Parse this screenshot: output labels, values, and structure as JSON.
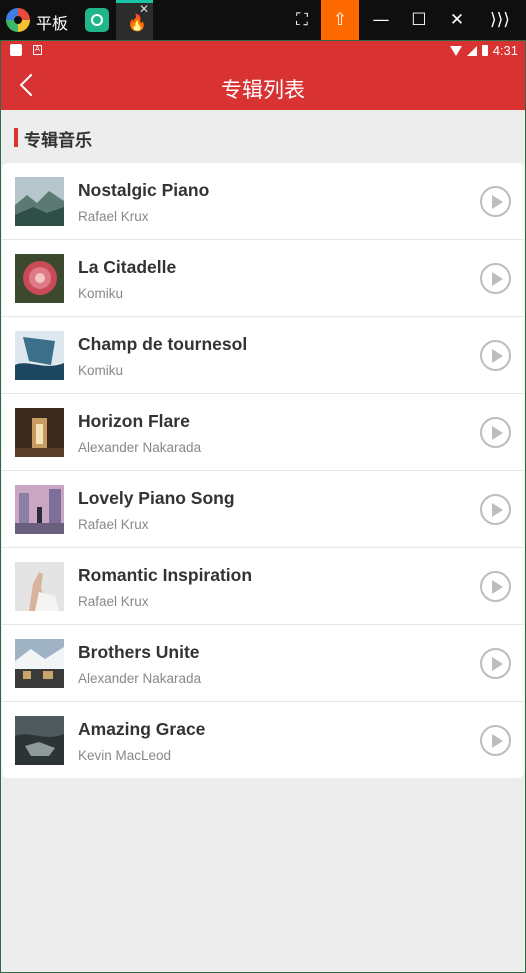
{
  "emulator": {
    "title": "平板",
    "controls": [
      "⛶",
      "⇧",
      "—",
      "☐",
      "✕",
      "⟩⟩⟩"
    ]
  },
  "status_bar": {
    "time": "4:31"
  },
  "header": {
    "title": "专辑列表"
  },
  "section": {
    "title": "专辑音乐"
  },
  "songs": [
    {
      "title": "Nostalgic Piano",
      "artist": "Rafael Krux"
    },
    {
      "title": "La Citadelle",
      "artist": "Komiku"
    },
    {
      "title": "Champ de tournesol",
      "artist": "Komiku"
    },
    {
      "title": "Horizon Flare",
      "artist": "Alexander Nakarada"
    },
    {
      "title": "Lovely Piano Song",
      "artist": "Rafael Krux"
    },
    {
      "title": "Romantic Inspiration",
      "artist": "Rafael Krux"
    },
    {
      "title": "Brothers Unite",
      "artist": "Alexander Nakarada"
    },
    {
      "title": "Amazing Grace",
      "artist": "Kevin MacLeod"
    }
  ],
  "colors": {
    "accent": "#d83232",
    "emulator_upload": "#ff6a00",
    "background": "#ededed"
  }
}
